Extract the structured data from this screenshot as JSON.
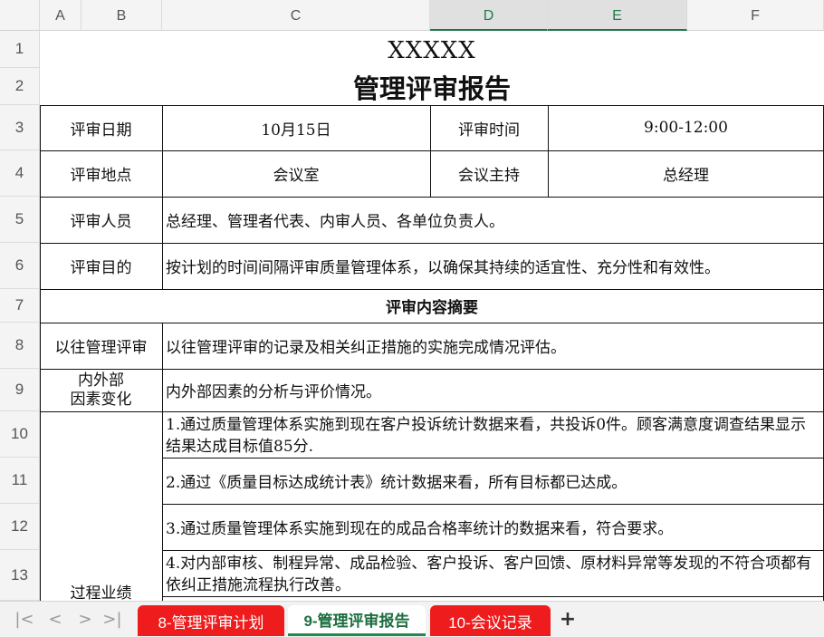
{
  "columns": [
    "A",
    "B",
    "C",
    "D",
    "E",
    "F"
  ],
  "rows": [
    "1",
    "2",
    "3",
    "4",
    "5",
    "6",
    "7",
    "8",
    "9",
    "10",
    "11",
    "12",
    "13"
  ],
  "sheet": {
    "company": "XXXXX",
    "title": "管理评审报告",
    "date_label": "评审日期",
    "date_value": "10月15日",
    "time_label": "评审时间",
    "time_value": "9:00-12:00",
    "place_label": "评审地点",
    "place_value": "会议室",
    "host_label": "会议主持",
    "host_value": "总经理",
    "people_label": "评审人员",
    "people_value": "总经理、管理者代表、内审人员、各单位负责人。",
    "purpose_label": "评审目的",
    "purpose_value": "按计划的时间间隔评审质量管理体系，以确保其持续的适宜性、充分性和有效性。",
    "summary_heading": "评审内容摘要",
    "previous_label": "以往管理评审",
    "previous_value": "以往管理评审的记录及相关纠正措施的实施完成情况评估。",
    "factors_label_1": "内外部",
    "factors_label_2": "因素变化",
    "factors_value": "内外部因素的分析与评价情况。",
    "process_label": "过程业绩",
    "item1": "1.通过质量管理体系实施到现在客户投诉统计数据来看，共投诉0件。顾客满意度调查结果显示结果达成目标值85分.",
    "item2": "2.通过《质量目标达成统计表》统计数据来看，所有目标都已达成。",
    "item3": "3.通过质量管理体系实施到现在的成品合格率统计的数据来看，符合要求。",
    "item4": "4.对内部审核、制程异常、成品检验、客户投诉、客户回馈、原材料异常等发现的不符合项都有依纠正措施流程执行改善。"
  },
  "tabs": [
    "8-管理评审计划",
    "9-管理评审报告",
    "10-会议记录"
  ],
  "nav": {
    "first": "|<",
    "prev": "<",
    "next": ">",
    "last": ">|",
    "add": "+"
  },
  "colors": {
    "tab_red": "#ee1c1c",
    "tab_active_text": "#1b6e3f",
    "selected_col": "#217346"
  }
}
